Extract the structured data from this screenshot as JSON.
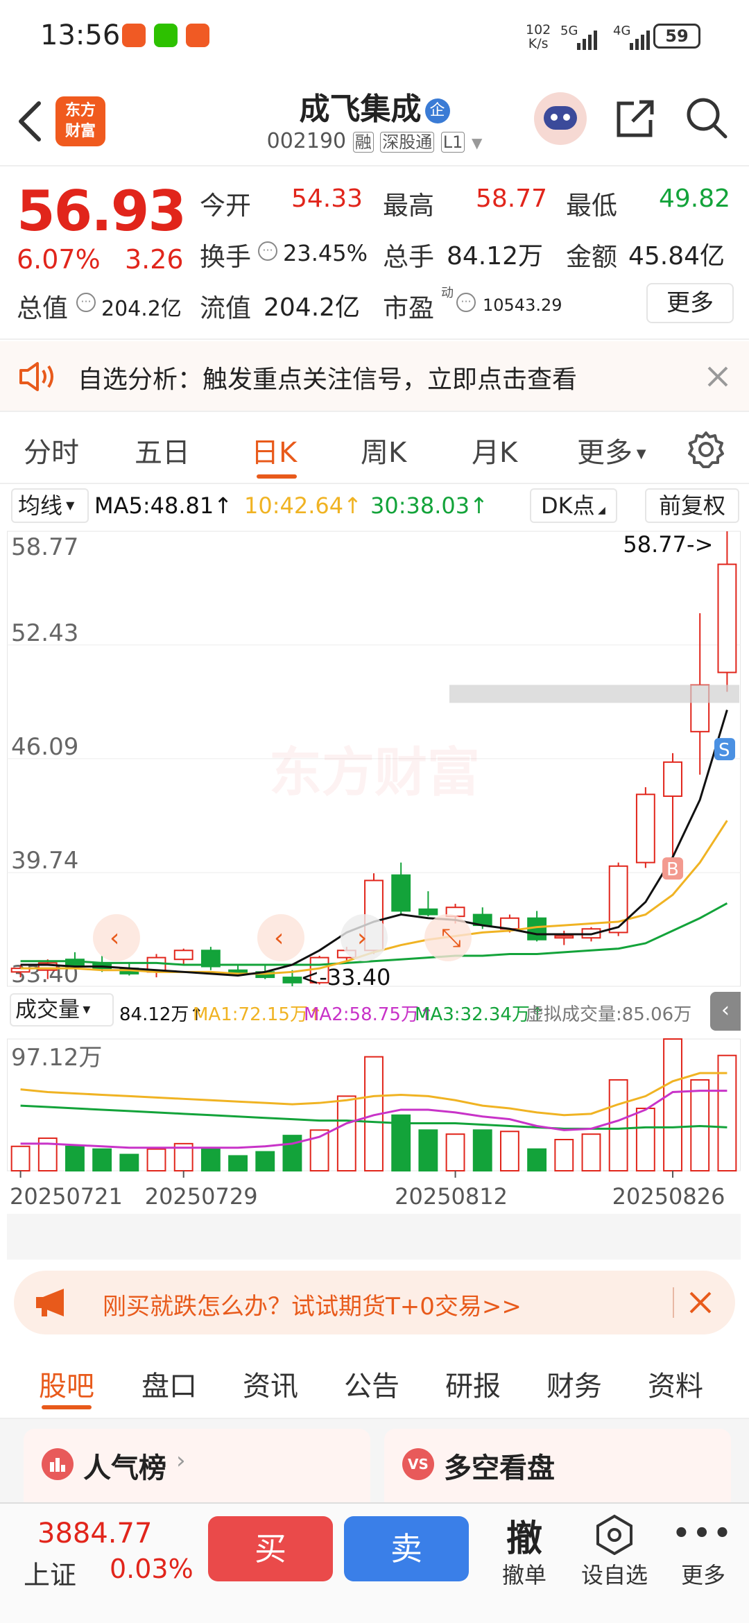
{
  "status_bar": {
    "time": "13:56",
    "net_speed_top": "102",
    "net_speed_bottom": "K/s",
    "signal1": "5G",
    "signal2": "4G",
    "battery": "59"
  },
  "header": {
    "logo_line1": "东方",
    "logo_line2": "财富",
    "stock_name": "成飞集成",
    "badge": "企",
    "code": "002190",
    "tag1": "融",
    "tag2": "深股通",
    "tag3": "L1"
  },
  "quote": {
    "price": "56.93",
    "change_pct": "6.07%",
    "change": "3.26",
    "open_label": "今开",
    "open": "54.33",
    "high_label": "最高",
    "high": "58.77",
    "low_label": "最低",
    "low": "49.82",
    "turnover_label": "换手",
    "turnover": "23.45%",
    "volume_label": "总手",
    "volume": "84.12万",
    "amount_label": "金额",
    "amount": "45.84亿",
    "mktcap_label": "总值",
    "mktcap": "204.2亿",
    "float_label": "流值",
    "float": "204.2亿",
    "pe_label": "市盈",
    "pe_sup": "动",
    "pe": "10543.29",
    "more": "更多"
  },
  "alert": {
    "text": "自选分析：触发重点关注信号，立即点击查看"
  },
  "tabs": [
    "分时",
    "五日",
    "日K",
    "周K",
    "月K",
    "更多"
  ],
  "active_tab": 2,
  "indicator_bar": {
    "ma_select": "均线",
    "ma5": "MA5:48.81↑",
    "ma10": "10:42.64↑",
    "ma30": "30:38.03↑",
    "dk": "DK点",
    "fq": "前复权"
  },
  "volume_bar": {
    "select": "成交量",
    "vol": "84.12万↑",
    "ma1": "MA1:72.15万↑",
    "ma2": "MA2:58.75万↑",
    "ma3": "MA3:32.34万↑",
    "virtual": "虚拟成交量:85.06万",
    "vmax": "97.12万"
  },
  "colors": {
    "up": "#e1251b",
    "down": "#13a33a",
    "accent": "#e85a1b",
    "ma5": "#111111",
    "ma10": "#f0b323",
    "ma30": "#13a33a",
    "vma2": "#c833c8"
  },
  "chart_data": {
    "type": "candlestick",
    "y_ticks": [
      "58.77",
      "52.43",
      "46.09",
      "39.74",
      "33.40"
    ],
    "ylim": [
      33.4,
      58.77
    ],
    "x_labels": [
      "20250721",
      "20250729",
      "20250812",
      "20250826"
    ],
    "high_marker": "58.77->",
    "low_marker": "<-33.40",
    "signal_b": "B",
    "signal_s": "S",
    "watermark": "东方财富",
    "candles": [
      {
        "o": 34.2,
        "h": 34.6,
        "l": 33.9,
        "c": 34.4
      },
      {
        "o": 34.3,
        "h": 34.9,
        "l": 33.8,
        "c": 34.7
      },
      {
        "o": 34.9,
        "h": 35.3,
        "l": 34.4,
        "c": 34.5
      },
      {
        "o": 34.7,
        "h": 35.1,
        "l": 34.2,
        "c": 34.4
      },
      {
        "o": 34.4,
        "h": 34.7,
        "l": 34.0,
        "c": 34.1
      },
      {
        "o": 34.2,
        "h": 35.2,
        "l": 33.9,
        "c": 35.0
      },
      {
        "o": 34.9,
        "h": 35.5,
        "l": 34.6,
        "c": 35.4
      },
      {
        "o": 35.4,
        "h": 35.6,
        "l": 34.3,
        "c": 34.5
      },
      {
        "o": 34.3,
        "h": 34.6,
        "l": 34.0,
        "c": 34.1
      },
      {
        "o": 34.2,
        "h": 34.6,
        "l": 33.8,
        "c": 33.9
      },
      {
        "o": 33.9,
        "h": 34.3,
        "l": 33.4,
        "c": 33.6
      },
      {
        "o": 33.6,
        "h": 35.1,
        "l": 33.5,
        "c": 35.0
      },
      {
        "o": 35.0,
        "h": 35.6,
        "l": 34.7,
        "c": 35.4
      },
      {
        "o": 35.4,
        "h": 39.7,
        "l": 35.2,
        "c": 39.3
      },
      {
        "o": 39.6,
        "h": 40.3,
        "l": 37.4,
        "c": 37.6
      },
      {
        "o": 37.7,
        "h": 38.7,
        "l": 37.3,
        "c": 37.4
      },
      {
        "o": 37.3,
        "h": 38.0,
        "l": 36.9,
        "c": 37.8
      },
      {
        "o": 37.4,
        "h": 37.8,
        "l": 36.6,
        "c": 36.8
      },
      {
        "o": 36.6,
        "h": 37.4,
        "l": 36.4,
        "c": 37.2
      },
      {
        "o": 37.2,
        "h": 37.6,
        "l": 35.9,
        "c": 36.0
      },
      {
        "o": 36.1,
        "h": 36.5,
        "l": 35.7,
        "c": 36.2
      },
      {
        "o": 36.1,
        "h": 36.7,
        "l": 35.9,
        "c": 36.6
      },
      {
        "o": 36.4,
        "h": 40.3,
        "l": 36.2,
        "c": 40.1
      },
      {
        "o": 40.3,
        "h": 44.5,
        "l": 40.0,
        "c": 44.1
      },
      {
        "o": 44.0,
        "h": 46.4,
        "l": 40.5,
        "c": 45.9
      },
      {
        "o": 47.6,
        "h": 54.2,
        "l": 45.2,
        "c": 50.2
      },
      {
        "o": 50.9,
        "h": 58.77,
        "l": 49.82,
        "c": 56.93
      }
    ],
    "ma5": [
      34.6,
      34.6,
      34.5,
      34.5,
      34.4,
      34.3,
      34.2,
      34.1,
      34.0,
      34.2,
      34.6,
      35.4,
      36.4,
      37.0,
      37.4,
      37.2,
      37.1,
      36.8,
      36.6,
      36.3,
      36.3,
      36.3,
      36.7,
      38.1,
      40.6,
      43.8,
      48.81
    ],
    "ma10": [
      34.4,
      34.4,
      34.4,
      34.3,
      34.3,
      34.2,
      34.2,
      34.2,
      34.1,
      34.1,
      34.2,
      34.4,
      34.8,
      35.3,
      35.7,
      36.0,
      36.2,
      36.4,
      36.5,
      36.7,
      36.8,
      36.9,
      37.0,
      37.4,
      38.5,
      40.3,
      42.64
    ],
    "ma30": [
      34.8,
      34.8,
      34.8,
      34.7,
      34.7,
      34.7,
      34.6,
      34.6,
      34.6,
      34.6,
      34.6,
      34.6,
      34.7,
      34.8,
      34.9,
      35.0,
      35.1,
      35.1,
      35.2,
      35.2,
      35.3,
      35.4,
      35.5,
      35.8,
      36.5,
      37.2,
      38.03
    ],
    "volumes": [
      18,
      24,
      18,
      16,
      12,
      16,
      20,
      16,
      11,
      14,
      26,
      30,
      55,
      84,
      41,
      30,
      27,
      30,
      29,
      16,
      23,
      27,
      67,
      46,
      97.12,
      67,
      85
    ],
    "vma1": [
      60,
      58,
      57,
      56,
      55,
      54,
      53,
      52,
      51,
      50,
      49,
      50,
      52,
      55,
      56,
      55,
      52,
      48,
      46,
      43,
      41,
      42,
      49,
      55,
      66,
      72,
      72
    ],
    "vma2": [
      20,
      20,
      19,
      18,
      17,
      17,
      17,
      17,
      17,
      18,
      20,
      25,
      35,
      41,
      45,
      45,
      43,
      40,
      38,
      33,
      30,
      31,
      37,
      45,
      58,
      59,
      59
    ],
    "vma3": [
      48,
      47,
      46,
      45,
      44,
      43,
      42,
      41,
      40,
      39,
      38,
      37,
      37,
      36,
      35,
      35,
      35,
      34,
      33,
      32,
      31,
      31,
      31,
      32,
      32,
      33,
      32
    ]
  },
  "promo": {
    "text": "刚买就跌怎么办？试试期货T+0交易>>"
  },
  "bottom_tabs": [
    "股吧",
    "盘口",
    "资讯",
    "公告",
    "研报",
    "财务",
    "资料"
  ],
  "cards": {
    "left": "人气榜",
    "right": "多空看盘"
  },
  "bottom_bar": {
    "index_value": "3884.77",
    "index_name": "上证",
    "index_change": "0.03%",
    "buy": "买",
    "sell": "卖",
    "cancel_icon": "撤",
    "cancel": "撤单",
    "watch": "设自选",
    "more": "更多"
  }
}
